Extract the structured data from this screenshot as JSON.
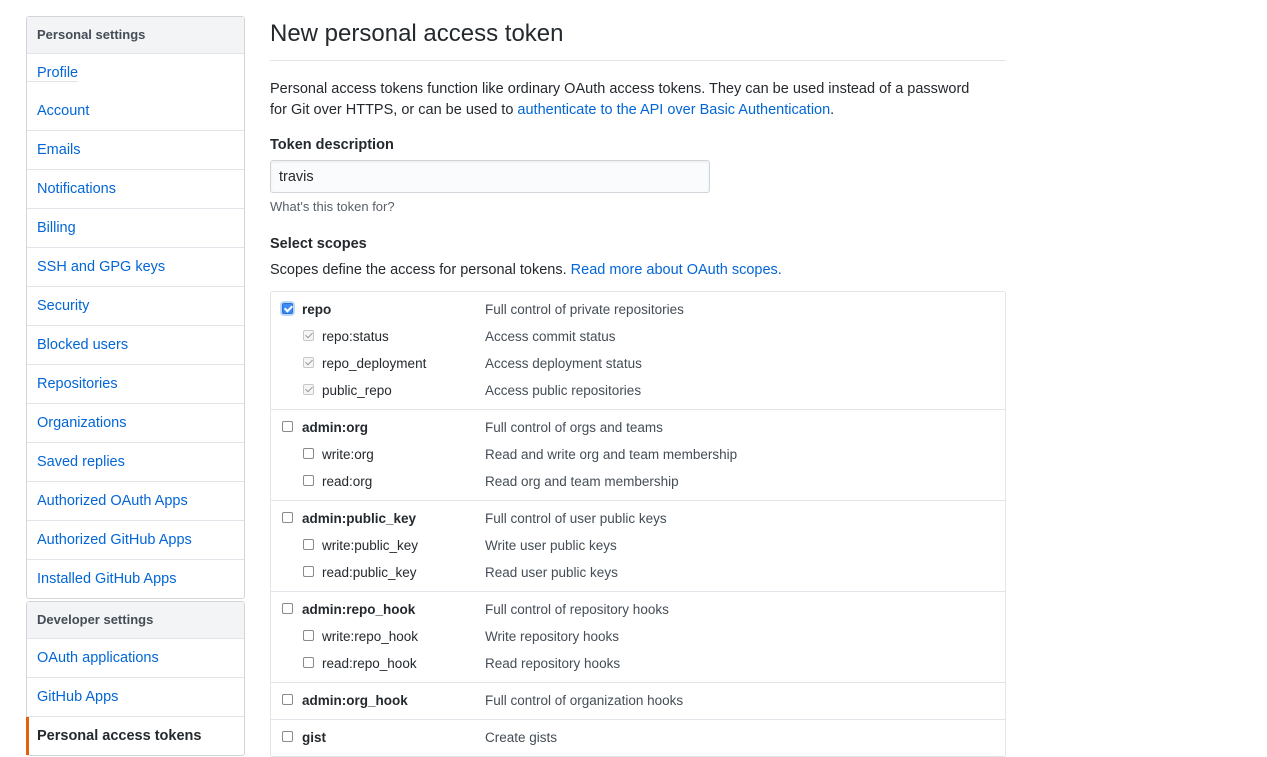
{
  "sidebar": {
    "personal": {
      "heading": "Personal settings",
      "items": [
        {
          "label": "Profile"
        },
        {
          "label": "Account"
        },
        {
          "label": "Emails"
        },
        {
          "label": "Notifications"
        },
        {
          "label": "Billing"
        },
        {
          "label": "SSH and GPG keys"
        },
        {
          "label": "Security"
        },
        {
          "label": "Blocked users"
        },
        {
          "label": "Repositories"
        },
        {
          "label": "Organizations"
        },
        {
          "label": "Saved replies"
        },
        {
          "label": "Authorized OAuth Apps"
        },
        {
          "label": "Authorized GitHub Apps"
        },
        {
          "label": "Installed GitHub Apps"
        }
      ]
    },
    "developer": {
      "heading": "Developer settings",
      "items": [
        {
          "label": "OAuth applications"
        },
        {
          "label": "GitHub Apps"
        },
        {
          "label": "Personal access tokens"
        }
      ]
    }
  },
  "main": {
    "title": "New personal access token",
    "lead_text": "Personal access tokens function like ordinary OAuth access tokens. They can be used instead of a password for Git over HTTPS, or can be used to ",
    "lead_link": "authenticate to the API over Basic Authentication",
    "lead_end": ".",
    "token_label": "Token description",
    "token_value": "travis",
    "token_note": "What's this token for?",
    "scopes_label": "Select scopes",
    "scopes_text": "Scopes define the access for personal tokens. ",
    "scopes_link": "Read more about OAuth scopes."
  },
  "scopes": [
    {
      "name": "repo",
      "desc": "Full control of private repositories",
      "checked": true,
      "subs": [
        {
          "name": "repo:status",
          "desc": "Access commit status",
          "checked": true
        },
        {
          "name": "repo_deployment",
          "desc": "Access deployment status",
          "checked": true
        },
        {
          "name": "public_repo",
          "desc": "Access public repositories",
          "checked": true
        }
      ]
    },
    {
      "name": "admin:org",
      "desc": "Full control of orgs and teams",
      "checked": false,
      "subs": [
        {
          "name": "write:org",
          "desc": "Read and write org and team membership",
          "checked": false
        },
        {
          "name": "read:org",
          "desc": "Read org and team membership",
          "checked": false
        }
      ]
    },
    {
      "name": "admin:public_key",
      "desc": "Full control of user public keys",
      "checked": false,
      "subs": [
        {
          "name": "write:public_key",
          "desc": "Write user public keys",
          "checked": false
        },
        {
          "name": "read:public_key",
          "desc": "Read user public keys",
          "checked": false
        }
      ]
    },
    {
      "name": "admin:repo_hook",
      "desc": "Full control of repository hooks",
      "checked": false,
      "subs": [
        {
          "name": "write:repo_hook",
          "desc": "Write repository hooks",
          "checked": false
        },
        {
          "name": "read:repo_hook",
          "desc": "Read repository hooks",
          "checked": false
        }
      ]
    },
    {
      "name": "admin:org_hook",
      "desc": "Full control of organization hooks",
      "checked": false,
      "subs": []
    },
    {
      "name": "gist",
      "desc": "Create gists",
      "checked": false,
      "subs": []
    }
  ]
}
